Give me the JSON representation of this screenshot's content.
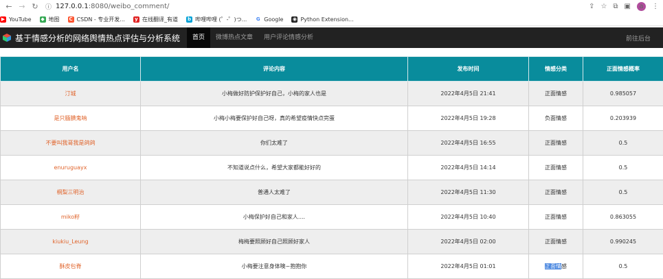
{
  "browser": {
    "url_host": "127.0.0.1",
    "url_path": ":8080/weibo_comment/",
    "avatar_letter": "a",
    "bookmarks": [
      {
        "label": "YouTube",
        "color": "#ff0000",
        "glyph": "▶"
      },
      {
        "label": "地图",
        "color": "#34a853",
        "glyph": "◆"
      },
      {
        "label": "CSDN - 专业开发...",
        "color": "#fc5531",
        "glyph": "C"
      },
      {
        "label": "在线翻译_有道",
        "color": "#e02020",
        "glyph": "y"
      },
      {
        "label": "哔哩哔哩 (゜-゜)つ...",
        "color": "#00a1d6",
        "glyph": "b"
      },
      {
        "label": "Google",
        "color": "#ffffff",
        "glyph": "G"
      },
      {
        "label": "Python Extension...",
        "color": "#222222",
        "glyph": "◉"
      }
    ]
  },
  "navbar": {
    "brand": "基于情感分析的网络舆情热点评估与分析系统",
    "items": [
      {
        "label": "首页",
        "active": true
      },
      {
        "label": "微博热点文章",
        "active": false
      },
      {
        "label": "用户评论情感分析",
        "active": false
      }
    ],
    "right_link": "前往后台"
  },
  "table": {
    "headers": [
      "用户名",
      "评论内容",
      "发布时间",
      "情感分类",
      "正面情感概率"
    ],
    "rows": [
      {
        "user": "汀城",
        "content": "小梅做好防护保护好自己，小梅的家人也是",
        "time": "2022年4月5日 21:41",
        "sentiment": "正面情感",
        "prob": "0.985057"
      },
      {
        "user": "是只腼腆鬼呐",
        "content": "小梅小梅要保护好自己呀，真的希望疫情快点完蛋",
        "time": "2022年4月5日 19:28",
        "sentiment": "负面情感",
        "prob": "0.203939"
      },
      {
        "user": "不要叫我哥我是鸽鸽",
        "content": "你们太难了",
        "time": "2022年4月5日 16:55",
        "sentiment": "正面情感",
        "prob": "0.5"
      },
      {
        "user": "enuruguayx",
        "content": "不知道说点什么，希望大家都能好好的",
        "time": "2022年4月5日 14:14",
        "sentiment": "正面情感",
        "prob": "0.5"
      },
      {
        "user": "桐梨三明治",
        "content": "普通人太难了",
        "time": "2022年4月5日 11:30",
        "sentiment": "正面情感",
        "prob": "0.5"
      },
      {
        "user": "miko籽",
        "content": "小梅保护好自己和家人....",
        "time": "2022年4月5日 10:40",
        "sentiment": "正面情感",
        "prob": "0.863055"
      },
      {
        "user": "kiukiu_Leung",
        "content": "梅梅要照顾好自己照顾好家人",
        "time": "2022年4月5日 02:00",
        "sentiment": "正面情感",
        "prob": "0.990245"
      },
      {
        "user": "酥皮包脊",
        "content": "小梅要注意身体噢~抱抱你",
        "time": "2022年4月5日 01:01",
        "sentiment_sel": "正面情",
        "sentiment_rest": "感",
        "prob": "0.5"
      }
    ]
  }
}
